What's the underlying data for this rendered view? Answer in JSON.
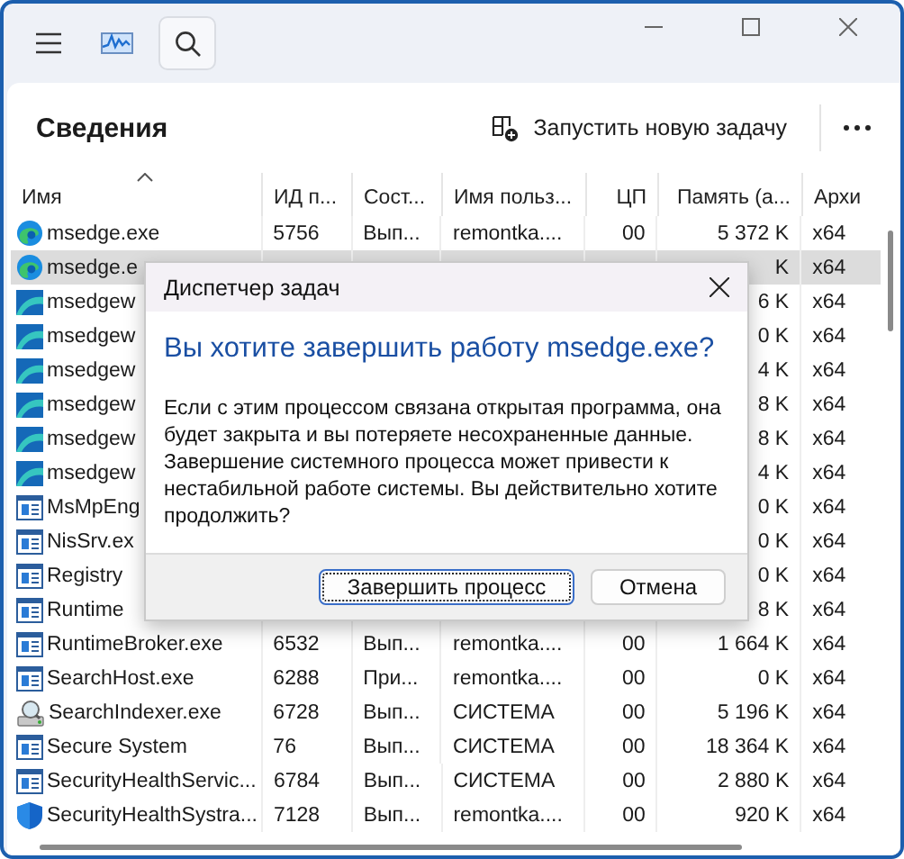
{
  "header": {
    "title": "Сведения",
    "new_task": "Запустить новую задачу"
  },
  "table": {
    "columns": [
      {
        "label": "Имя",
        "sorted": true
      },
      {
        "label": "ИД п...",
        "sorted": false
      },
      {
        "label": "Сост...",
        "sorted": false
      },
      {
        "label": "Имя польз...",
        "sorted": false
      },
      {
        "label": "ЦП",
        "sorted": false
      },
      {
        "label": "Память (а...",
        "sorted": false
      },
      {
        "label": "Архи",
        "sorted": false
      }
    ],
    "rows": [
      {
        "kind": "edge",
        "selected": false,
        "cells": [
          "msedge.exe",
          "5756",
          "Вып...",
          "remontka....",
          "00",
          "5 372 K",
          "x64"
        ]
      },
      {
        "kind": "edge",
        "selected": true,
        "cells": [
          "msedge.e",
          "",
          "",
          "",
          "",
          "K",
          "x64"
        ]
      },
      {
        "kind": "webview",
        "selected": false,
        "cells": [
          "msedgew",
          "",
          "",
          "",
          "",
          "6 K",
          "x64"
        ]
      },
      {
        "kind": "webview",
        "selected": false,
        "cells": [
          "msedgew",
          "",
          "",
          "",
          "",
          "0 K",
          "x64"
        ]
      },
      {
        "kind": "webview",
        "selected": false,
        "cells": [
          "msedgew",
          "",
          "",
          "",
          "",
          "4 K",
          "x64"
        ]
      },
      {
        "kind": "webview",
        "selected": false,
        "cells": [
          "msedgew",
          "",
          "",
          "",
          "",
          "8 K",
          "x64"
        ]
      },
      {
        "kind": "webview",
        "selected": false,
        "cells": [
          "msedgew",
          "",
          "",
          "",
          "",
          "8 K",
          "x64"
        ]
      },
      {
        "kind": "webview",
        "selected": false,
        "cells": [
          "msedgew",
          "",
          "",
          "",
          "",
          "4 K",
          "x64"
        ]
      },
      {
        "kind": "app",
        "selected": false,
        "cells": [
          "MsMpEng",
          "",
          "",
          "",
          "",
          "0 K",
          "x64"
        ]
      },
      {
        "kind": "app",
        "selected": false,
        "cells": [
          "NisSrv.ex",
          "",
          "",
          "",
          "",
          "0 K",
          "x64"
        ]
      },
      {
        "kind": "app",
        "selected": false,
        "cells": [
          "Registry",
          "",
          "",
          "",
          "",
          "0 K",
          "x64"
        ]
      },
      {
        "kind": "app",
        "selected": false,
        "cells": [
          "Runtime",
          "",
          "",
          "",
          "",
          "8 K",
          "x64"
        ]
      },
      {
        "kind": "app",
        "selected": false,
        "cells": [
          "RuntimeBroker.exe",
          "6532",
          "Вып...",
          "remontka....",
          "00",
          "1 664 K",
          "x64"
        ]
      },
      {
        "kind": "app",
        "selected": false,
        "cells": [
          "SearchHost.exe",
          "6288",
          "При...",
          "remontka....",
          "00",
          "0 K",
          "x64"
        ]
      },
      {
        "kind": "indexer",
        "selected": false,
        "cells": [
          "SearchIndexer.exe",
          "6728",
          "Вып...",
          "СИСТЕМА",
          "00",
          "5 196 K",
          "x64"
        ]
      },
      {
        "kind": "app",
        "selected": false,
        "cells": [
          "Secure System",
          "76",
          "Вып...",
          "СИСТЕМА",
          "00",
          "18 364 K",
          "x64"
        ]
      },
      {
        "kind": "app",
        "selected": false,
        "cells": [
          "SecurityHealthServic...",
          "6784",
          "Вып...",
          "СИСТЕМА",
          "00",
          "2 880 K",
          "x64"
        ]
      },
      {
        "kind": "shield",
        "selected": false,
        "cells": [
          "SecurityHealthSystra...",
          "7128",
          "Вып...",
          "remontka....",
          "00",
          "920 K",
          "x64"
        ]
      }
    ]
  },
  "dialog": {
    "title": "Диспетчер задач",
    "heading": "Вы хотите завершить работу msedge.exe?",
    "message": "Если с  этим процессом связана открытая программа, она будет закрыта и вы потеряете несохраненные данные. Завершение системного процесса может привести к нестабильной работе системы. Вы действительно хотите продолжить?",
    "buttons": [
      {
        "label": "Завершить процесс",
        "focused": true
      },
      {
        "label": "Отмена",
        "focused": false
      }
    ]
  }
}
